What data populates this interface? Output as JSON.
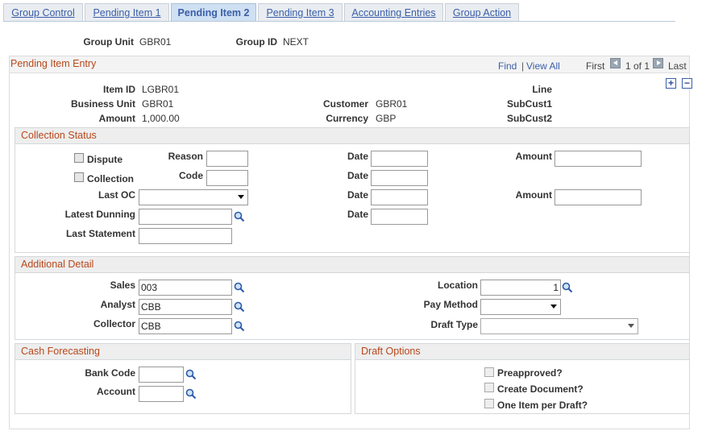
{
  "tabs": [
    {
      "label": "Group Control",
      "active": false
    },
    {
      "label": "Pending Item 1",
      "active": false
    },
    {
      "label": "Pending Item 2",
      "active": true
    },
    {
      "label": "Pending Item 3",
      "active": false
    },
    {
      "label": "Accounting Entries",
      "active": false
    },
    {
      "label": "Group Action",
      "active": false
    }
  ],
  "header": {
    "group_unit_label": "Group Unit",
    "group_unit": "GBR01",
    "group_id_label": "Group ID",
    "group_id": "NEXT"
  },
  "entry": {
    "title": "Pending Item Entry",
    "nav": {
      "find": "Find",
      "sep": "|",
      "view_all": "View All",
      "first": "First",
      "count": "1 of 1",
      "last": "Last"
    },
    "item_id_label": "Item ID",
    "item_id": "LGBR01",
    "business_unit_label": "Business Unit",
    "business_unit": "GBR01",
    "amount_label": "Amount",
    "amount": "1,000.00",
    "customer_label": "Customer",
    "customer": "GBR01",
    "currency_label": "Currency",
    "currency": "GBP",
    "line_label": "Line",
    "subcust1_label": "SubCust1",
    "subcust2_label": "SubCust2"
  },
  "collection": {
    "title": "Collection Status",
    "dispute_label": "Dispute",
    "collection_label": "Collection",
    "reason_label": "Reason",
    "code_label": "Code",
    "date_label": "Date",
    "amount_label": "Amount",
    "last_oc_label": "Last OC",
    "latest_dunning_label": "Latest Dunning",
    "last_statement_label": "Last Statement"
  },
  "additional": {
    "title": "Additional Detail",
    "sales_label": "Sales",
    "sales": "003",
    "analyst_label": "Analyst",
    "analyst": "CBB",
    "collector_label": "Collector",
    "collector": "CBB",
    "location_label": "Location",
    "location": "1",
    "pay_method_label": "Pay Method",
    "draft_type_label": "Draft Type"
  },
  "cash": {
    "title": "Cash Forecasting",
    "bank_code_label": "Bank Code",
    "account_label": "Account"
  },
  "draft": {
    "title": "Draft Options",
    "preapproved": "Preapproved?",
    "create_document": "Create Document?",
    "one_item": "One Item per Draft?"
  },
  "colors": {
    "tab_link": "#3a5ea8",
    "section_title": "#b8471b"
  }
}
